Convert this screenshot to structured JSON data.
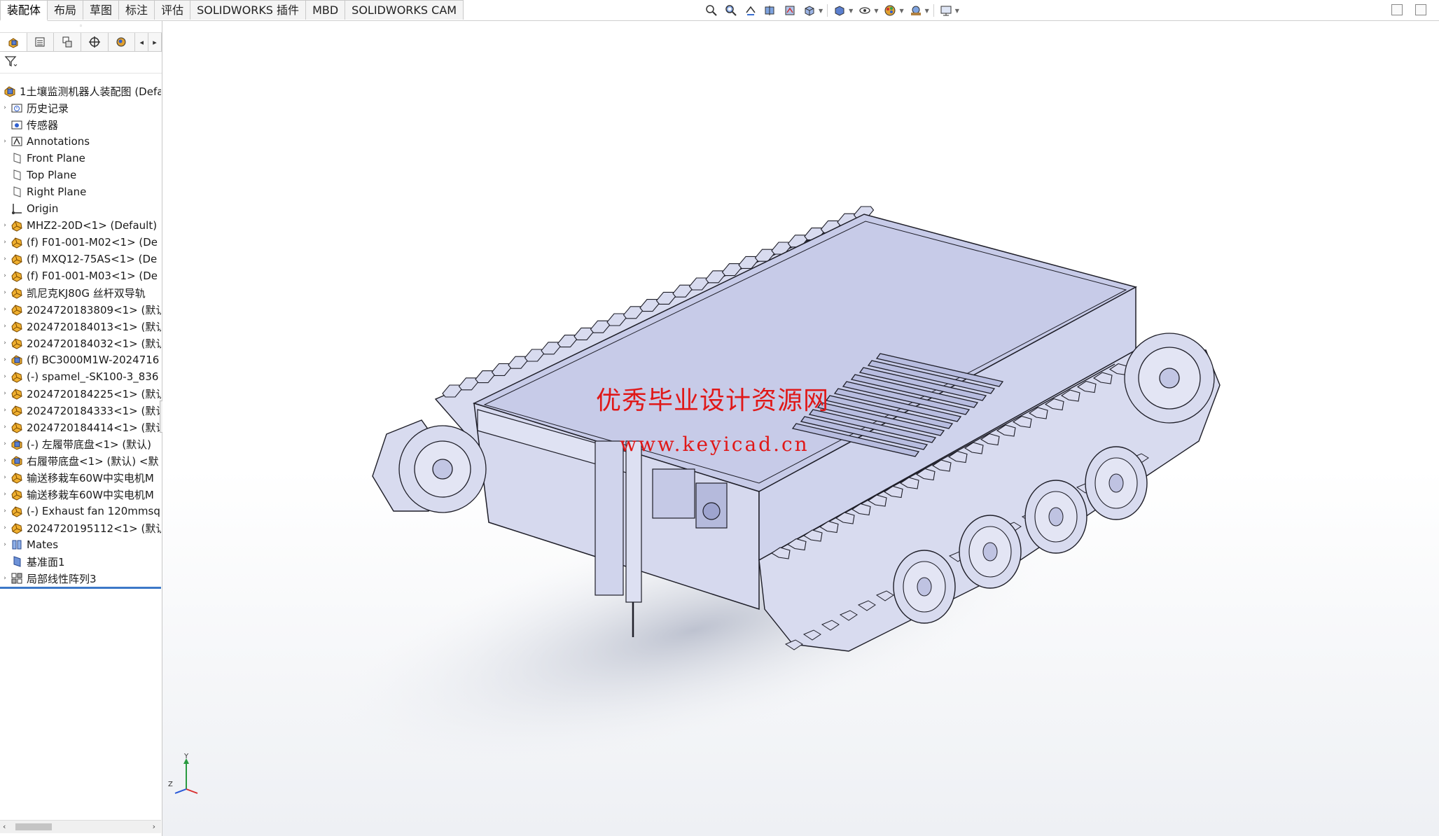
{
  "tabs": [
    {
      "label": "装配体",
      "active": true
    },
    {
      "label": "布局",
      "active": false
    },
    {
      "label": "草图",
      "active": false
    },
    {
      "label": "标注",
      "active": false
    },
    {
      "label": "评估",
      "active": false
    },
    {
      "label": "SOLIDWORKS 插件",
      "active": false
    },
    {
      "label": "MBD",
      "active": false
    },
    {
      "label": "SOLIDWORKS CAM",
      "active": false
    }
  ],
  "headsup_icons": [
    "zoom-to-fit-icon",
    "zoom-area-icon",
    "previous-view-icon",
    "section-view-icon",
    "dynamic-annotation-icon",
    "view-orientation-icon",
    "display-style-icon",
    "hide-show-icon",
    "edit-appearance-icon",
    "apply-scene-icon",
    "view-settings-icon"
  ],
  "tree": {
    "root": "1土壤监测机器人装配图 (Defa",
    "items": [
      {
        "label": "历史记录",
        "icon": "history-folder-icon",
        "expandable": true
      },
      {
        "label": "传感器",
        "icon": "sensor-folder-icon",
        "expandable": false
      },
      {
        "label": "Annotations",
        "icon": "annotations-icon",
        "expandable": true
      },
      {
        "label": "Front Plane",
        "icon": "plane-icon",
        "expandable": false
      },
      {
        "label": "Top Plane",
        "icon": "plane-icon",
        "expandable": false
      },
      {
        "label": "Right Plane",
        "icon": "plane-icon",
        "expandable": false
      },
      {
        "label": "Origin",
        "icon": "origin-icon",
        "expandable": false
      },
      {
        "label": "MHZ2-20D<1> (Default)",
        "icon": "part-icon",
        "expandable": true
      },
      {
        "label": "(f) F01-001-M02<1> (De",
        "icon": "part-icon",
        "expandable": true
      },
      {
        "label": "(f) MXQ12-75AS<1> (De",
        "icon": "part-icon",
        "expandable": true
      },
      {
        "label": "(f) F01-001-M03<1> (De",
        "icon": "part-icon",
        "expandable": true
      },
      {
        "label": "凯尼克KJ80G  丝杆双导轨",
        "icon": "part-icon",
        "expandable": true
      },
      {
        "label": "2024720183809<1> (默认",
        "icon": "part-icon",
        "expandable": true
      },
      {
        "label": "2024720184013<1> (默认",
        "icon": "part-icon",
        "expandable": true
      },
      {
        "label": "2024720184032<1> (默认",
        "icon": "part-icon",
        "expandable": true
      },
      {
        "label": "(f) BC3000M1W-2024716",
        "icon": "subassembly-icon",
        "expandable": true
      },
      {
        "label": "(-) spamel_-SK100-3_836",
        "icon": "part-icon",
        "expandable": true
      },
      {
        "label": "2024720184225<1> (默认",
        "icon": "part-icon",
        "expandable": true
      },
      {
        "label": "2024720184333<1> (默认",
        "icon": "part-icon",
        "expandable": true
      },
      {
        "label": "2024720184414<1> (默认",
        "icon": "part-icon",
        "expandable": true
      },
      {
        "label": "(-) 左履带底盘<1> (默认)",
        "icon": "subassembly-icon",
        "expandable": true
      },
      {
        "label": "右履带底盘<1> (默认) <默",
        "icon": "subassembly-icon",
        "expandable": true
      },
      {
        "label": "输送移栽车60W中实电机M",
        "icon": "part-icon",
        "expandable": true
      },
      {
        "label": "输送移栽车60W中实电机M",
        "icon": "part-icon",
        "expandable": true
      },
      {
        "label": "(-) Exhaust fan 120mmsq",
        "icon": "part-icon",
        "expandable": true
      },
      {
        "label": "2024720195112<1> (默认",
        "icon": "part-icon",
        "expandable": true
      },
      {
        "label": "Mates",
        "icon": "mates-icon",
        "expandable": true
      },
      {
        "label": "基准面1",
        "icon": "plane-icon-blue",
        "expandable": false
      },
      {
        "label": "局部线性阵列3",
        "icon": "pattern-icon",
        "expandable": true
      }
    ]
  },
  "watermark": {
    "line1": "优秀毕业设计资源网",
    "line2": "www.keyicad.cn"
  },
  "triad": {
    "y": "Y",
    "z": "Z"
  },
  "colors": {
    "model_fill": "#d8dbef",
    "model_top": "#c7cbe8",
    "model_edge": "#1e1e28",
    "shadow": "#c4c8d4",
    "watermark": "#e01818",
    "part_icon": "#f0b030",
    "accent_line": "#3c78c8"
  }
}
